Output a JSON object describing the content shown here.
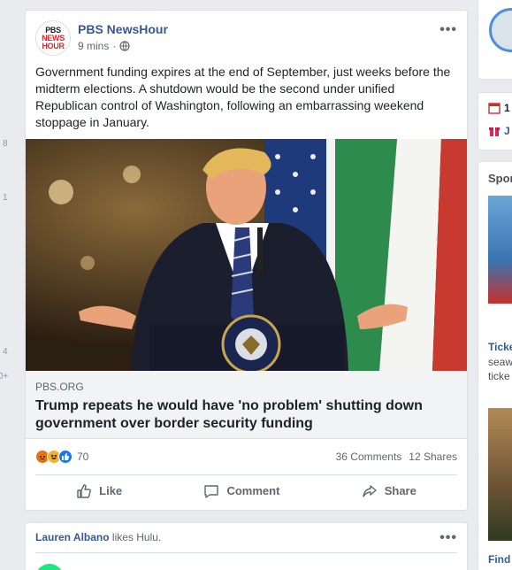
{
  "left_numbers": [
    "8",
    "1",
    "4",
    "0+"
  ],
  "post": {
    "page_name": "PBS NewsHour",
    "avatar_text_top": "PBS",
    "avatar_text_mid": "NEWS",
    "avatar_text_bot": "HOUR",
    "time": "9 mins",
    "separator": "·",
    "privacy_icon": "globe-icon",
    "more_label": "•••",
    "text": "Government funding expires at the end of September, just weeks before the midterm elections. A shutdown would be the second under unified Republican control of Washington, following an embarrassing weekend stoppage in January.",
    "link": {
      "domain": "PBS.ORG",
      "title": "Trump repeats he would have 'no problem' shutting down government over border security funding"
    },
    "reactions": {
      "icons": [
        "angry-reaction-icon",
        "haha-reaction-icon",
        "like-reaction-icon"
      ],
      "count": "70",
      "comments": "36 Comments",
      "shares": "12 Shares"
    },
    "actions": {
      "like": "Like",
      "comment": "Comment",
      "share": "Share"
    }
  },
  "post2": {
    "actor": "Lauren Albano",
    "verb": " likes Hulu.",
    "more_label": "•••"
  },
  "right_col": {
    "date": "1",
    "gift": "J",
    "sponsored": "Spor",
    "ad1_title": "Ticke",
    "ad1_desc": "seaw Our l ticke",
    "ad2_title": "Find"
  },
  "colors": {
    "link_blue": "#365899",
    "background": "#e9ebee",
    "like_blue": "#1877f2",
    "angry_orange": "#e9710f",
    "haha_yellow": "#f7b125"
  }
}
